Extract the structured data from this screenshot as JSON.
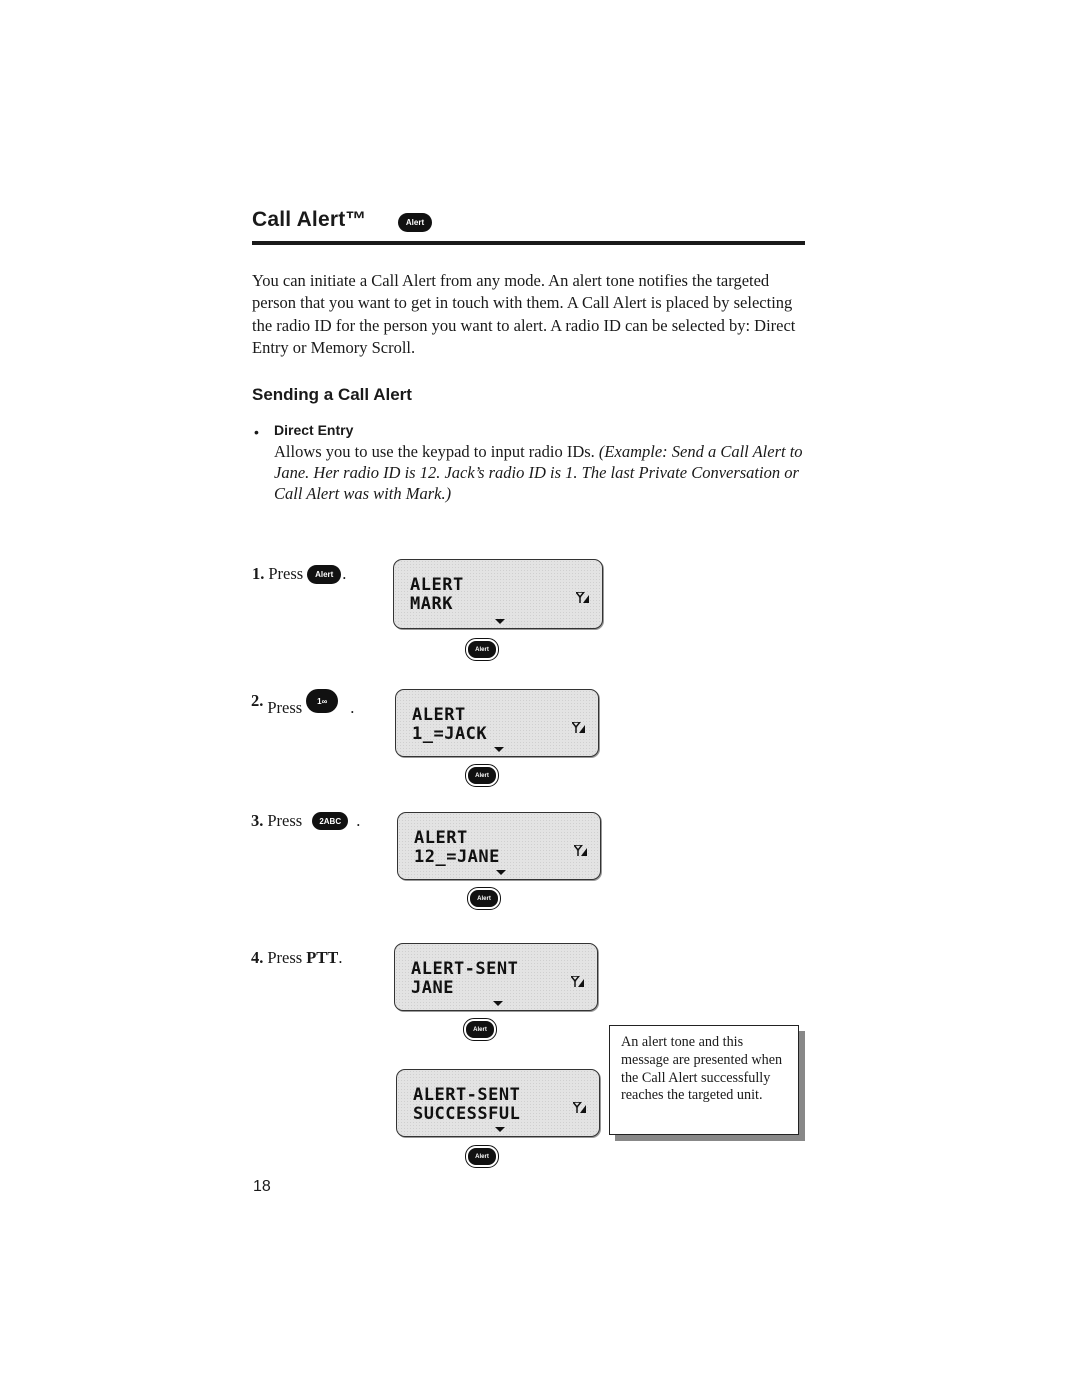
{
  "header": {
    "title": "Call Alert™",
    "title_key_label": "Alert"
  },
  "intro": "You can initiate a Call Alert from any mode. An alert tone notifies the target­ed person that you want to get in touch with them. A Call Alert is placed by selecting the radio ID for the person you want to alert. A radio ID can be selected by: Direct Entry or Memory Scroll.",
  "section": {
    "heading": "Sending a Call Alert",
    "bullet_symbol": "•",
    "bullet_label": "Direct Entry",
    "bullet_text": "Allows you to use the keypad to input radio IDs. ",
    "bullet_example": "(Example: Send a Call Alert to Jane. Her radio ID is 12. Jack’s radio ID is 1. The last Private Conversation or Call Alert was with Mark.)"
  },
  "steps": [
    {
      "number": "1.",
      "verb": "Press",
      "key_label": "Alert",
      "suffix": "."
    },
    {
      "number": "2.",
      "verb": "Press",
      "key_label": "1∞",
      "suffix": "."
    },
    {
      "number": "3.",
      "verb": "Press",
      "key_label": "2ABC",
      "suffix": "."
    },
    {
      "number": "4.",
      "verb": "Press",
      "key_label": "PTT",
      "suffix": "."
    }
  ],
  "screens": [
    {
      "line1": "ALERT",
      "line2": "MARK",
      "key_label": "Alert"
    },
    {
      "line1": "ALERT",
      "line2": "1_=JACK",
      "key_label": "Alert"
    },
    {
      "line1": "ALERT",
      "line2": "12_=JANE",
      "key_label": "Alert"
    },
    {
      "line1": "ALERT-SENT",
      "line2": "JANE",
      "key_label": "Alert"
    },
    {
      "line1": "ALERT-SENT",
      "line2": "SUCCESSFUL",
      "key_label": "Alert"
    }
  ],
  "note": "An alert tone and this message are presented when the Call Alert suc­cessfully reaches the tar­geted unit.",
  "page_number": "18"
}
